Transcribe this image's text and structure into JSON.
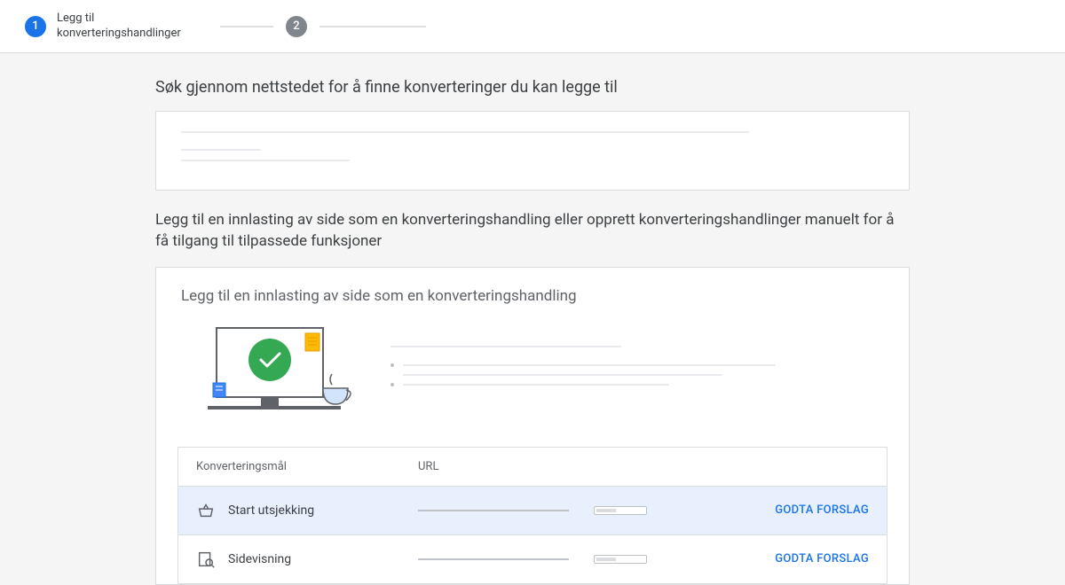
{
  "stepper": {
    "step1_num": "1",
    "step1_label": "Legg til konverteringshandlinger",
    "step2_num": "2"
  },
  "section1": {
    "title": "Søk gjennom nettstedet for å finne konverteringer du kan legge til"
  },
  "section2": {
    "title": "Legg til en innlasting av side som en konverteringshandling eller opprett konverteringshandlinger manuelt for å få tilgang til tilpassede funksjoner",
    "card_title": "Legg til en innlasting av side som en konverteringshandling"
  },
  "table": {
    "header_goal": "Konverteringsmål",
    "header_url": "URL",
    "rows": [
      {
        "label": "Start utsjekking",
        "action": "GODTA FORSLAG"
      },
      {
        "label": "Sidevisning",
        "action": "GODTA FORSLAG"
      }
    ]
  }
}
